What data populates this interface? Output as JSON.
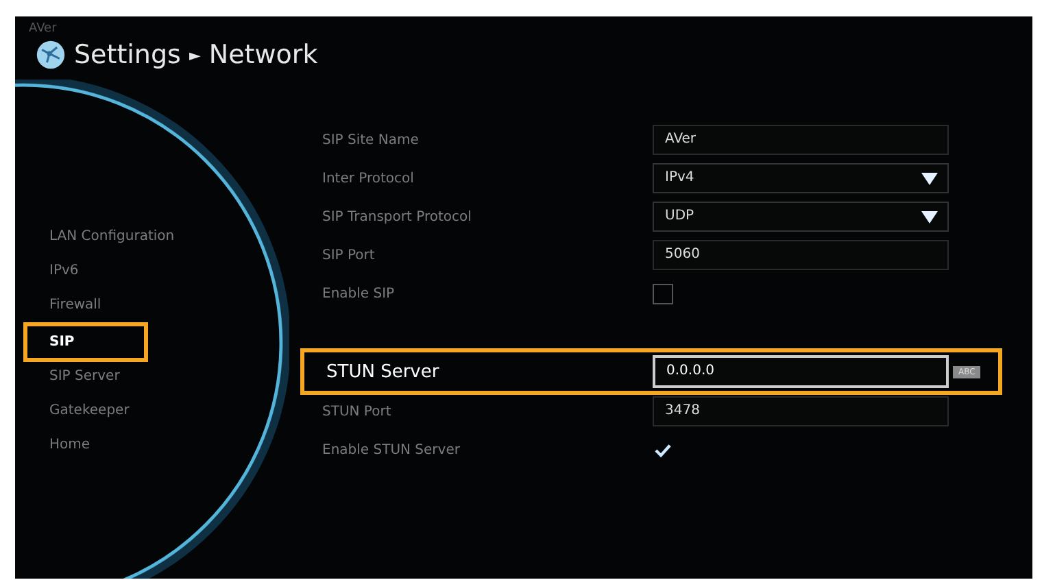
{
  "logo": "AVer",
  "header": {
    "title": "Settings",
    "separator": "►",
    "subtitle": "Network"
  },
  "sidebar": {
    "items": [
      {
        "label": "LAN Configuration",
        "selected": false
      },
      {
        "label": "IPv6",
        "selected": false
      },
      {
        "label": "Firewall",
        "selected": false
      },
      {
        "label": "SIP",
        "selected": true
      },
      {
        "label": "SIP Server",
        "selected": false
      },
      {
        "label": "Gatekeeper",
        "selected": false
      },
      {
        "label": "Home",
        "selected": false
      }
    ]
  },
  "form": {
    "rows": [
      {
        "kind": "text",
        "label": "SIP Site Name",
        "value": "AVer",
        "focused": false
      },
      {
        "kind": "select",
        "label": "Inter Protocol",
        "value": "IPv4",
        "focused": false
      },
      {
        "kind": "select",
        "label": "SIP Transport Protocol",
        "value": "UDP",
        "focused": false
      },
      {
        "kind": "text",
        "label": "SIP Port",
        "value": "5060",
        "focused": false
      },
      {
        "kind": "checkbox",
        "label": "Enable SIP",
        "checked": false,
        "focused": false
      },
      {
        "kind": "text",
        "label": "STUN Server",
        "value": "0.0.0.0",
        "badge": "ABC",
        "focused": true
      },
      {
        "kind": "text",
        "label": "STUN Port",
        "value": "3478",
        "focused": false
      },
      {
        "kind": "checkbox",
        "label": "Enable STUN Server",
        "checked": true,
        "focused": false
      }
    ]
  }
}
